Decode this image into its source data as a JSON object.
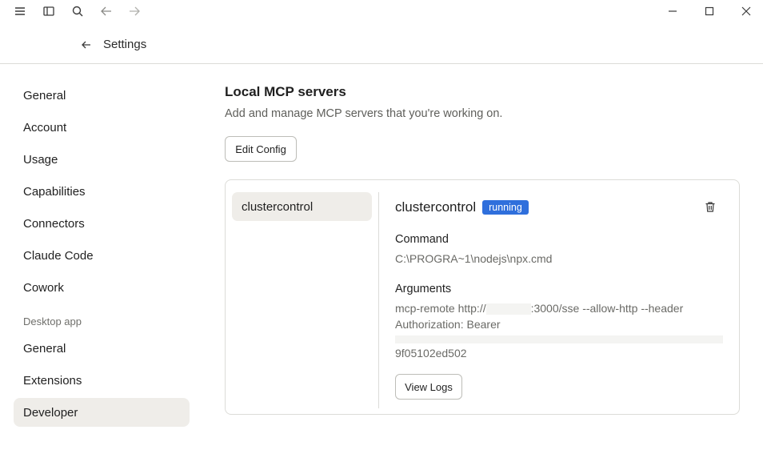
{
  "window": {
    "icons": [
      "menu-icon",
      "sidebar-toggle-icon",
      "search-icon",
      "back-arrow-icon",
      "forward-arrow-icon",
      "minimize-icon",
      "maximize-icon",
      "close-icon"
    ]
  },
  "header": {
    "title": "Settings"
  },
  "sidebar": {
    "items": [
      "General",
      "Account",
      "Usage",
      "Capabilities",
      "Connectors",
      "Claude Code",
      "Cowork"
    ],
    "section_label": "Desktop app",
    "desktop_items": [
      "General",
      "Extensions",
      "Developer"
    ],
    "active": "Developer"
  },
  "main": {
    "title": "Local MCP servers",
    "description": "Add and manage MCP servers that you're working on.",
    "edit_config_label": "Edit Config"
  },
  "servers": [
    {
      "name": "clustercontrol"
    }
  ],
  "detail": {
    "name": "clustercontrol",
    "status": "running",
    "status_color": "#2f6fdc",
    "command_label": "Command",
    "command_value": "C:\\PROGRA~1\\nodejs\\npx.cmd",
    "arguments_label": "Arguments",
    "arguments_line1_pre": "mcp-remote http://",
    "arguments_line1_post": ":3000/sse --allow-http --header",
    "arguments_line2": "Authorization: Bearer",
    "arguments_line4": "9f05102ed502",
    "view_logs_label": "View Logs"
  }
}
